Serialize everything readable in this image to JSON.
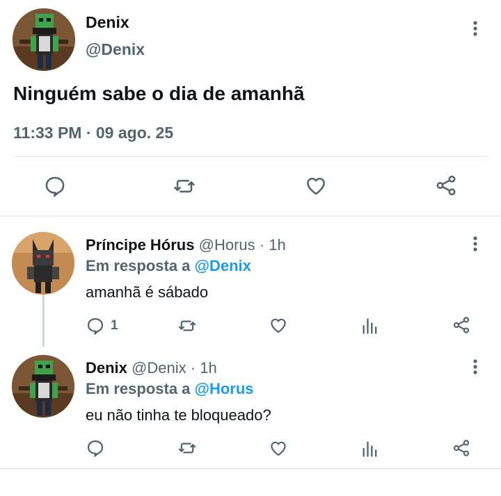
{
  "main_tweet": {
    "author_name": "Denix",
    "author_handle": "@Denix",
    "text": "Ninguém sabe o dia de amanhã",
    "timestamp": "11:33 PM · 09 ago. 25"
  },
  "replies": [
    {
      "author_name": "Príncipe Hórus",
      "author_handle": "@Horus",
      "age": "· 1h",
      "reply_prefix": "Em resposta a",
      "reply_to": "@Denix",
      "text": "amanhã é sábado",
      "reply_count": "1"
    },
    {
      "author_name": "Denix",
      "author_handle": "@Denix",
      "age": "· 1h",
      "reply_prefix": "Em resposta a",
      "reply_to": "@Horus",
      "text": "eu não tinha te bloqueado?",
      "reply_count": ""
    }
  ],
  "icons": {
    "more": "vertical-ellipsis",
    "reply": "speech-bubble",
    "retweet": "retweet-arrows",
    "like": "heart-outline",
    "views": "bar-chart",
    "share": "share-nodes"
  },
  "colors": {
    "text": "#0f1419",
    "muted": "#536471",
    "link": "#1d9bf0",
    "divider": "#e3e6e8"
  }
}
